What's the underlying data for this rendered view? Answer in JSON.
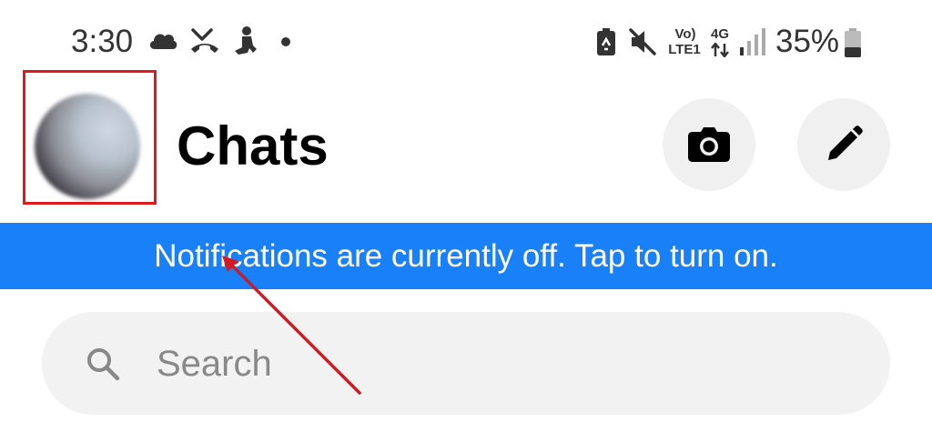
{
  "status_bar": {
    "time": "3:30",
    "network_top": "Vo)",
    "network_lte": "LTE1",
    "network_4g": "4G",
    "battery": "35%",
    "left_icons": [
      "cloud-icon",
      "missed-call-icon",
      "person-icon",
      "dot-icon"
    ],
    "right_icons": [
      "battery-saver-icon",
      "mute-icon",
      "volte-icon",
      "4g-icon",
      "signal-icon",
      "battery-icon"
    ]
  },
  "header": {
    "title": "Chats",
    "avatar": "avatar",
    "camera_button": "camera-icon",
    "compose_button": "pencil-icon"
  },
  "notification_banner": {
    "text": "Notifications are currently off. Tap to turn on."
  },
  "search": {
    "placeholder": "Search",
    "icon": "search-icon"
  },
  "colors": {
    "banner": "#1a80f7",
    "annotation": "#e0191f",
    "button_bg": "#f0f0f0",
    "search_bg": "#f2f2f2"
  }
}
